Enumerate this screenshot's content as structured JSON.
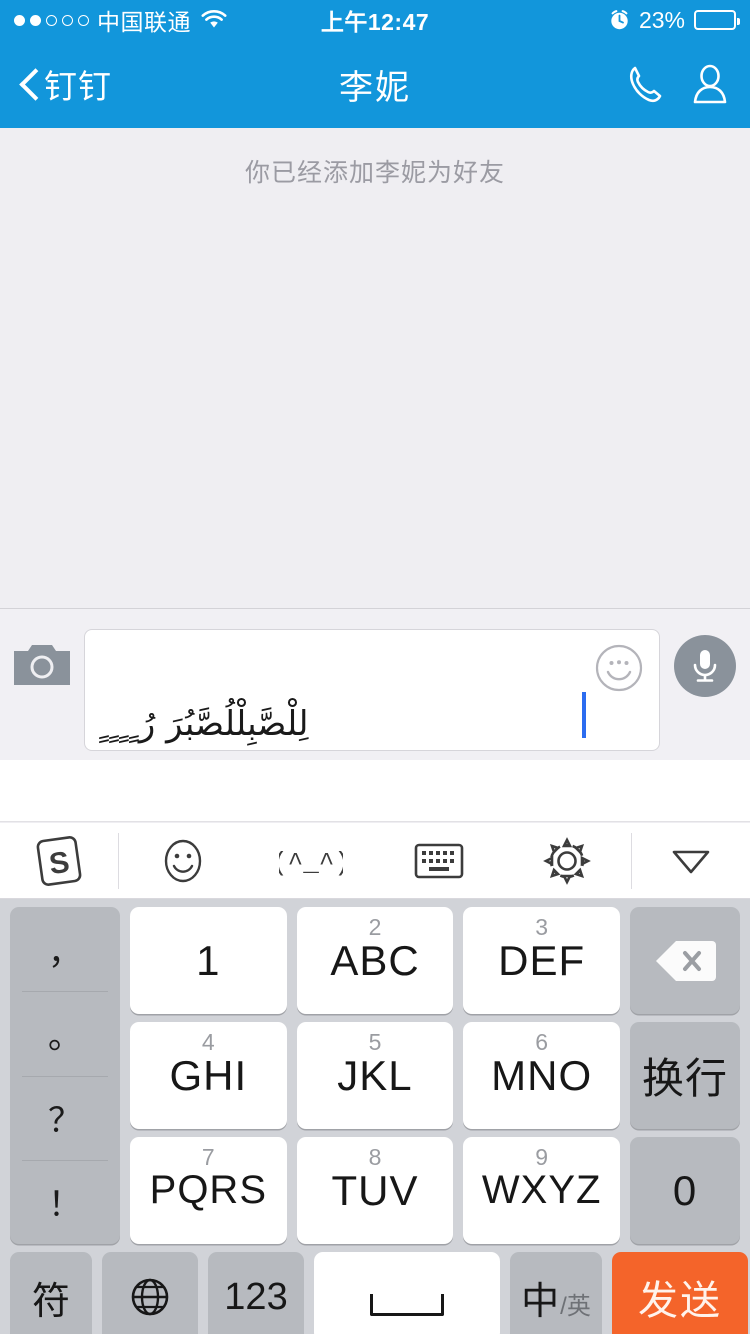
{
  "status_bar": {
    "signal_dots_filled": 2,
    "signal_dots_total": 5,
    "carrier": "中国联通",
    "wifi_icon": "wifi-icon",
    "time": "上午12:47",
    "alarm_icon": "alarm-clock-icon",
    "battery_percent": "23%",
    "battery_level": 23
  },
  "nav_bar": {
    "back_icon": "chevron-left-icon",
    "back_label": "钉钉",
    "title": "李妮",
    "call_icon": "phone-icon",
    "profile_icon": "person-icon"
  },
  "chat": {
    "system_message": "你已经添加李妮为好友"
  },
  "input_bar": {
    "camera_icon": "camera-icon",
    "emoji_icon": "smiley-face-icon",
    "mic_icon": "microphone-icon",
    "text_value": "لِلْصَّبِلْلُصَّبُرَ رُ ٍ ٍ ٍ ٍ",
    "placeholder": ""
  },
  "keyboard_toolbar": {
    "logo": "sogou-logo-icon",
    "items": [
      {
        "name": "emoji-icon",
        "glyph": ""
      },
      {
        "name": "kaomoji-icon",
        "glyph": "(^_^)"
      },
      {
        "name": "keyboard-layout-icon",
        "glyph": ""
      },
      {
        "name": "settings-gear-icon",
        "glyph": ""
      }
    ],
    "collapse_icon": "chevron-down-icon"
  },
  "keypad": {
    "punctuation": [
      "，",
      "。",
      "？",
      "！"
    ],
    "keys": [
      {
        "sub": "",
        "main": "1",
        "style": "white"
      },
      {
        "sub": "2",
        "main": "ABC",
        "style": "white"
      },
      {
        "sub": "3",
        "main": "DEF",
        "style": "white"
      },
      {
        "sub": "4",
        "main": "GHI",
        "style": "white"
      },
      {
        "sub": "5",
        "main": "JKL",
        "style": "white"
      },
      {
        "sub": "6",
        "main": "MNO",
        "style": "white"
      },
      {
        "sub": "7",
        "main": "PQRS",
        "style": "white"
      },
      {
        "sub": "8",
        "main": "TUV",
        "style": "white"
      },
      {
        "sub": "9",
        "main": "WXYZ",
        "style": "white"
      }
    ],
    "backspace_icon": "backspace-icon",
    "enter_label": "换行",
    "zero_label": "0",
    "bottom_row": {
      "symbol_label": "符",
      "globe_icon": "globe-icon",
      "numeric_label": "123",
      "space_icon": "space-bar-icon",
      "lang_cn": "中",
      "lang_en": "/英",
      "send_label": "发送"
    }
  },
  "colors": {
    "brand_blue": "#1296DB",
    "send_orange": "#F4642A",
    "chat_bg": "#EFEEF2",
    "keypad_bg": "#D1D3D8",
    "key_gray": "#B7BABF",
    "caret_blue": "#2B6CF0"
  }
}
